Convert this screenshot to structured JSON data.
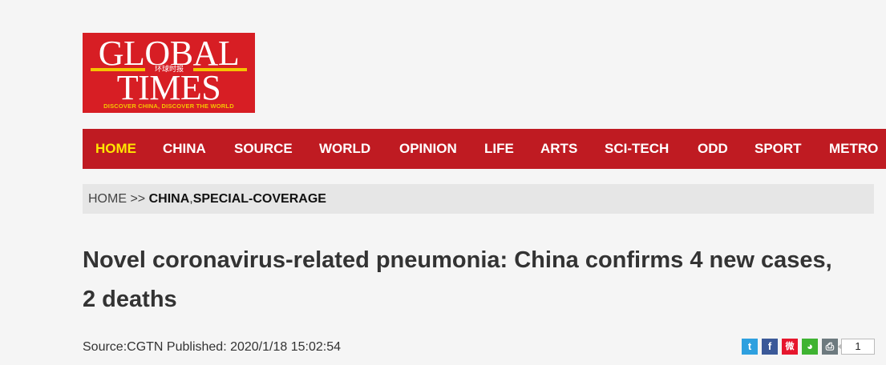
{
  "logo": {
    "line1": "GLOBAL",
    "line2": "TIMES",
    "chinese": "环球时报",
    "tagline": "DISCOVER CHINA, DISCOVER THE WORLD",
    "brand_color": "#d71e24",
    "accent_color": "#f5c400"
  },
  "nav": {
    "items": [
      {
        "label": "HOME",
        "active": true
      },
      {
        "label": "CHINA"
      },
      {
        "label": "SOURCE"
      },
      {
        "label": "WORLD"
      },
      {
        "label": "OPINION"
      },
      {
        "label": "LIFE"
      },
      {
        "label": "ARTS"
      },
      {
        "label": "SCI-TECH"
      },
      {
        "label": "ODD"
      },
      {
        "label": "SPORT"
      },
      {
        "label": "METRO"
      }
    ],
    "background": "#bf1b22",
    "active_color": "#ffe600"
  },
  "breadcrumb": {
    "home": "HOME",
    "separator": " >> ",
    "category1": "CHINA",
    "comma": ",",
    "category2": "SPECIAL-COVERAGE"
  },
  "article": {
    "headline_line1": "Novel coronavirus-related pneumonia: China confirms 4 new cases,",
    "headline_line2": "2 deaths",
    "meta": "Source:CGTN Published: 2020/1/18 15:02:54"
  },
  "share": {
    "buttons": [
      {
        "icon": "twitter-icon",
        "glyph": "t",
        "color": "#2ea0df"
      },
      {
        "icon": "facebook-icon",
        "glyph": "f",
        "color": "#3b5998"
      },
      {
        "icon": "weibo-icon",
        "glyph": "微",
        "color": "#e6162d"
      },
      {
        "icon": "wechat-icon",
        "glyph": "◕",
        "color": "#3fb332"
      },
      {
        "icon": "print-icon",
        "glyph": "⎙",
        "color": "#6d7a7f"
      }
    ],
    "count": "1"
  }
}
